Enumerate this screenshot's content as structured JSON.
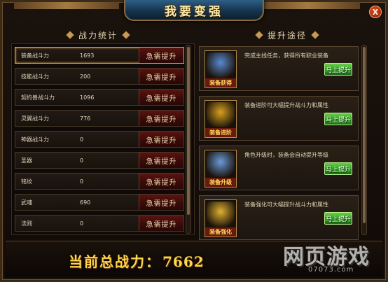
{
  "window": {
    "title": "我要变强",
    "close_label": "X"
  },
  "left": {
    "header": "战力统计",
    "rows": [
      {
        "name": "装备战斗力",
        "value": "1693",
        "button": "急需提升",
        "active": true
      },
      {
        "name": "技能战斗力",
        "value": "200",
        "button": "急需提升"
      },
      {
        "name": "契约兽战斗力",
        "value": "1096",
        "button": "急需提升"
      },
      {
        "name": "灵翼战斗力",
        "value": "776",
        "button": "急需提升"
      },
      {
        "name": "神器战斗力",
        "value": "0",
        "button": "急需提升"
      },
      {
        "name": "圣器",
        "value": "0",
        "button": "急需提升"
      },
      {
        "name": "铭纹",
        "value": "0",
        "button": "急需提升"
      },
      {
        "name": "武魂",
        "value": "690",
        "button": "急需提升"
      },
      {
        "name": "法则",
        "value": "0",
        "button": "急需提升"
      }
    ]
  },
  "right": {
    "header": "提升途径",
    "cards": [
      {
        "icon_name": "equipment-obtain-icon",
        "caption": "装备获得",
        "desc": "完成主线任务，获得所有职业装备",
        "button": "马上提升",
        "art_color": "#5a8ad0"
      },
      {
        "icon_name": "equipment-advance-icon",
        "caption": "装备进阶",
        "desc": "装备进阶可大幅提升战斗力和属性",
        "button": "马上提升",
        "art_color": "#d8a020"
      },
      {
        "icon_name": "equipment-upgrade-icon",
        "caption": "装备升级",
        "desc": "角色升级时，装备会自动提升等级",
        "button": "马上提升",
        "art_color": "#6a9ad8"
      },
      {
        "icon_name": "equipment-enhance-icon",
        "caption": "装备强化",
        "desc": "装备强化可大幅提升战斗力和属性",
        "button": "马上提升",
        "art_color": "#e0b030"
      }
    ]
  },
  "footer": {
    "total_label": "当前总战力：",
    "total_value": "7662"
  },
  "watermark": {
    "logo": "网页游戏",
    "domain": "07073.com"
  }
}
